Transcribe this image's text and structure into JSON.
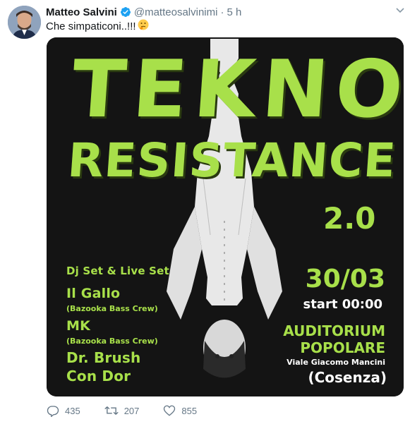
{
  "tweet": {
    "author_name": "Matteo Salvini",
    "handle": "@matteosalvinimi",
    "separator": "·",
    "time": "5 h",
    "text": "Che simpaticoni..!!!",
    "emoji": "🤔"
  },
  "poster": {
    "title_line1": "TEKNO",
    "title_line2": "RESISTANCE",
    "edition": "2.0",
    "subtitle": "Dj Set & Live Set",
    "lineup": [
      {
        "name": "Il Gallo",
        "crew": "(Bazooka Bass Crew)"
      },
      {
        "name": "MK",
        "crew": "(Bazooka Bass Crew)"
      },
      {
        "name": "Dr. Brush",
        "crew": ""
      },
      {
        "name": "Con Dor",
        "crew": ""
      }
    ],
    "date": "30/03",
    "start": "start 00:00",
    "venue_line1": "AUDITORIUM",
    "venue_line2": "POPOLARE",
    "address": "Viale Giacomo Mancini",
    "city": "(Cosenza)"
  },
  "actions": {
    "replies": "435",
    "retweets": "207",
    "likes": "855"
  },
  "colors": {
    "poster_green": "#a8e04a",
    "verified_blue": "#1da1f2",
    "muted_gray": "#657786"
  }
}
